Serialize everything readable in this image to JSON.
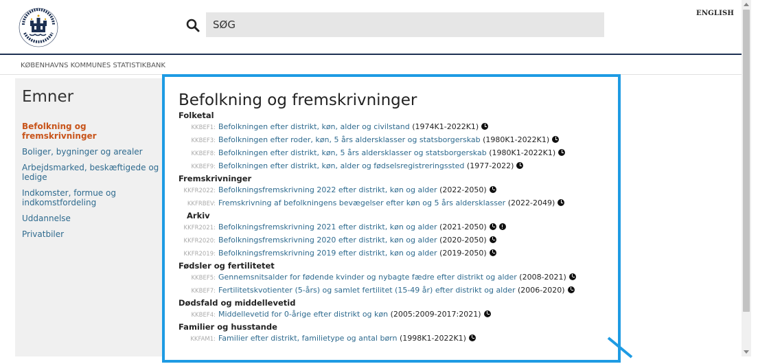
{
  "header": {
    "logo_alt": "Københavns Kommune",
    "search_placeholder": "SØG",
    "language_link": "ENGLISH"
  },
  "breadcrumb": "KØBENHAVNS KOMMUNES STATISTIKBANK",
  "sidebar": {
    "title": "Emner",
    "items": [
      {
        "label": "Befolkning og fremskrivninger",
        "active": true
      },
      {
        "label": "Boliger, bygninger og arealer"
      },
      {
        "label": "Arbejdsmarked, beskæftigede og ledige"
      },
      {
        "label": "Indkomster, formue og indkomstfordeling"
      },
      {
        "label": "Uddannelse"
      },
      {
        "label": "Privatbiler"
      }
    ]
  },
  "main": {
    "title": "Befolkning og fremskrivninger",
    "sections": [
      {
        "title": "Folketal",
        "rows": [
          {
            "code": "KKBEF1:",
            "label": "Befolkningen efter distrikt, køn, alder og civilstand",
            "years": "(1974K1-2022K1)"
          },
          {
            "code": "KKBEF3:",
            "label": "Befolkningen efter roder, køn, 5 års aldersklasser og statsborgerskab",
            "years": "(1980K1-2022K1)"
          },
          {
            "code": "KKBEF8:",
            "label": "Befolkningen efter distrikt, køn, 5 års aldersklasser og statsborgerskab",
            "years": "(1980K1-2022K1)"
          },
          {
            "code": "KKBEF9:",
            "label": "Befolkningen efter distrikt, køn, alder og fødselsregistreringssted",
            "years": "(1977-2022)"
          }
        ]
      },
      {
        "title": "Fremskrivninger",
        "rows": [
          {
            "code": "KKFR2022:",
            "label": "Befolkningsfremskrivning 2022 efter distrikt, køn og alder",
            "years": "(2022-2050)"
          },
          {
            "code": "KKFRBEV:",
            "label": "Fremskrivning af befolkningens bevægelser efter køn og 5 års aldersklasser",
            "years": "(2022-2049)"
          }
        ]
      },
      {
        "title": "Arkiv",
        "sub": true,
        "rows": [
          {
            "code": "KKFR2021:",
            "label": "Befolkningsfremskrivning 2021 efter distrikt, køn og alder",
            "years": "(2021-2050)",
            "alert": true
          },
          {
            "code": "KKFR2020:",
            "label": "Befolkningsfremskrivning 2020 efter distrikt, køn og alder",
            "years": "(2020-2050)"
          },
          {
            "code": "KKFR2019:",
            "label": "Befolkningsfremskrivning 2019 efter distrikt, køn og alder",
            "years": "(2019-2050)"
          }
        ]
      },
      {
        "title": "Fødsler og fertilitetet",
        "rows": [
          {
            "code": "KKBEF5:",
            "label": "Gennemsnitsalder for fødende kvinder og nybagte fædre efter distrikt og alder",
            "years": "(2008-2021)"
          },
          {
            "code": "KKBEF7:",
            "label": "Fertilitetskvotienter (5-års) og samlet fertilitet (15-49 år) efter distrikt og alder",
            "years": "(2006-2020)"
          }
        ]
      },
      {
        "title": "Dødsfald og middellevetid",
        "rows": [
          {
            "code": "KKBEF4:",
            "label": "Middellevetid for 0-årige efter distrikt og køn",
            "years": "(2005:2009-2017:2021)"
          }
        ]
      },
      {
        "title": "Familier og husstande",
        "rows": [
          {
            "code": "KKFAM1:",
            "label": "Familier efter distrikt, familietype og antal børn",
            "years": "(1998K1-2022K1)"
          }
        ]
      }
    ]
  },
  "colors": {
    "accent_border": "#1e9be3",
    "link": "#2e6a8e",
    "active": "#c8541a",
    "header_rule": "#1d3052"
  }
}
